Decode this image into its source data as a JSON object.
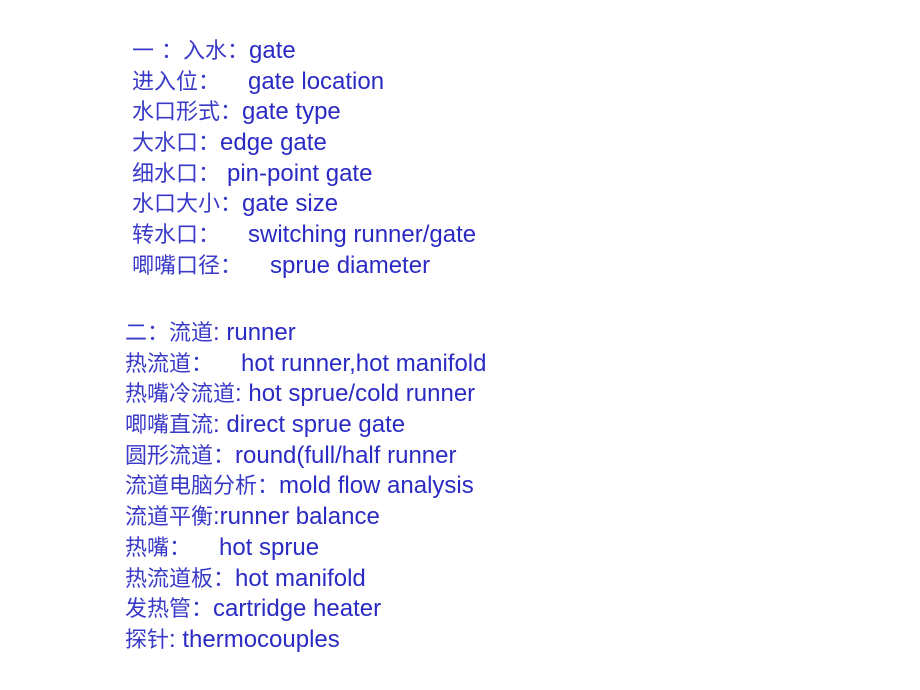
{
  "text_color": "#2b2bc4",
  "sections": [
    {
      "lines": [
        {
          "zh": "一 ：入水：",
          "en": "gate"
        },
        {
          "zh": "进入位：    ",
          "en": "gate location"
        },
        {
          "zh": "水口形式：",
          "en": "gate type"
        },
        {
          "zh": "大水口：",
          "en": "edge gate"
        },
        {
          "zh": "细水口： ",
          "en": "pin-point gate"
        },
        {
          "zh": "水口大小：",
          "en": "gate size"
        },
        {
          "zh": "转水口：    ",
          "en": "switching runner/gate"
        },
        {
          "zh": "唧嘴口径：    ",
          "en": "sprue diameter"
        }
      ]
    },
    {
      "lines": [
        {
          "zh": "二：流道",
          "en": ": runner"
        },
        {
          "zh": "热流道：    ",
          "en": "hot runner,hot manifold"
        },
        {
          "zh": "热嘴冷流道",
          "en": ": hot sprue/cold runner"
        },
        {
          "zh": "唧嘴直流",
          "en": ": direct sprue gate"
        },
        {
          "zh": "圆形流道：",
          "en": "round(full/half runner"
        },
        {
          "zh": "流道电脑分析：",
          "en": "mold flow analysis"
        },
        {
          "zh": "流道平衡",
          "en": ":runner balance"
        },
        {
          "zh": "热嘴：    ",
          "en": "hot sprue"
        },
        {
          "zh": "热流道板：",
          "en": "hot manifold"
        },
        {
          "zh": "发热管：",
          "en": "cartridge heater"
        },
        {
          "zh": "探针",
          "en": ": thermocouples"
        }
      ]
    }
  ]
}
